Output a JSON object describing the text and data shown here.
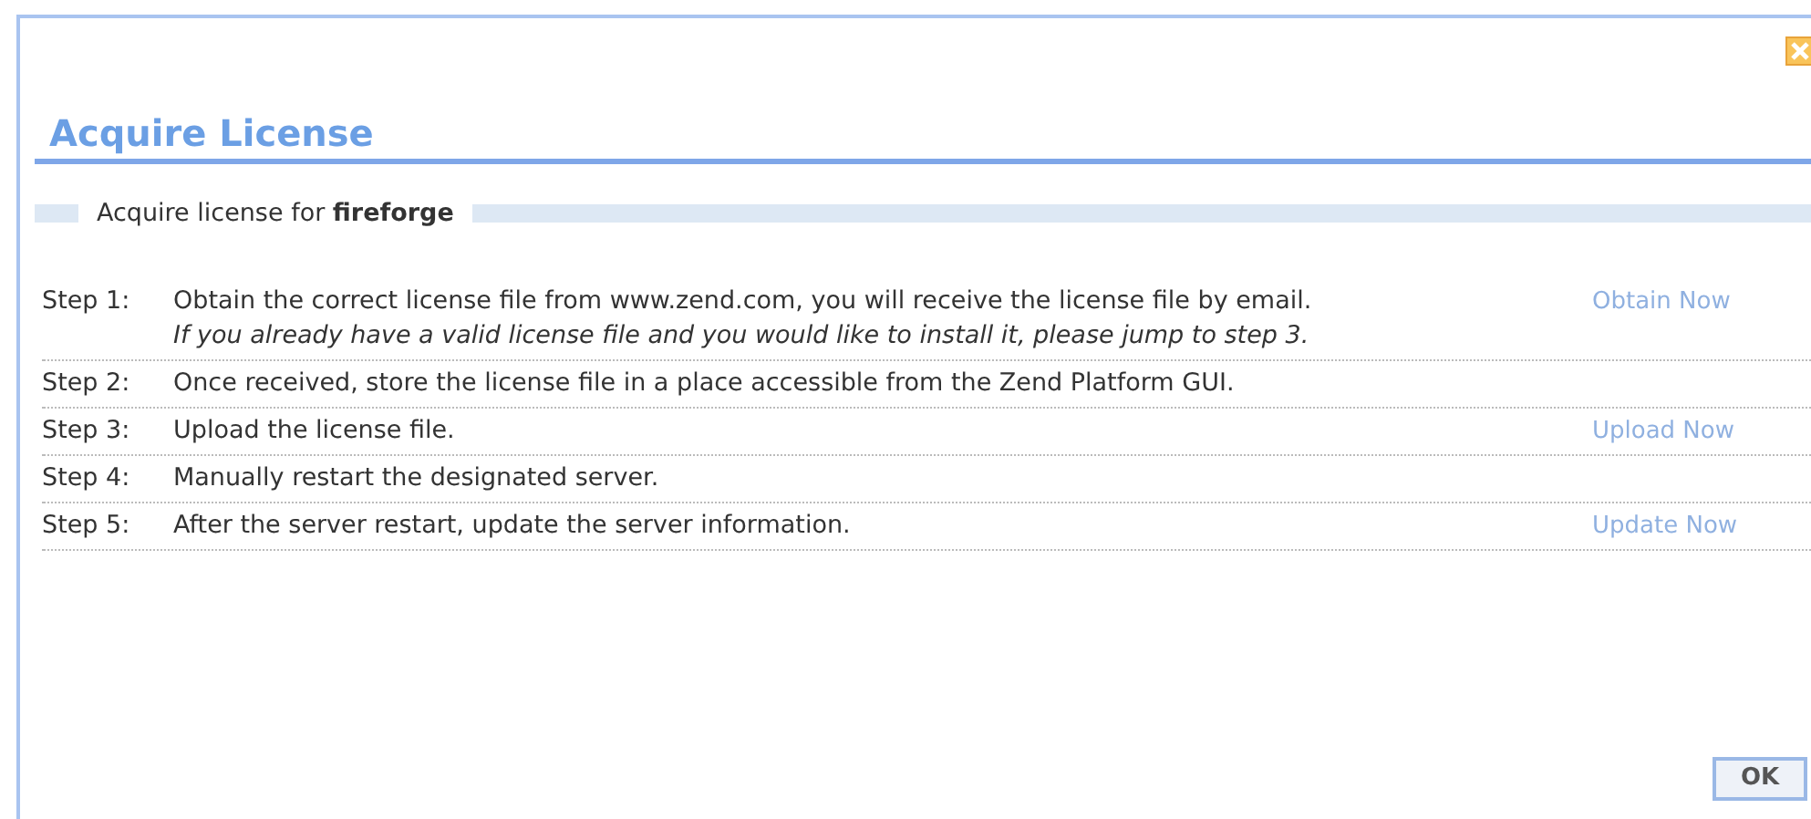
{
  "dialog": {
    "title": "Acquire License",
    "subtitle": "Acquire license for **fireforge**"
  },
  "steps": [
    {
      "label": "Step 1:",
      "text": "Obtain the correct license file from www.zend.com, you will receive the license file by email.",
      "note": "If you already have a valid license file and you would like to install it, please jump to step 3.",
      "action": "Obtain Now"
    },
    {
      "label": "Step 2:",
      "text": "Once received, store the license file in a place accessible from the Zend Platform GUI."
    },
    {
      "label": "Step 3:",
      "text": "Upload the license file.",
      "action": "Upload Now"
    },
    {
      "label": "Step 4:",
      "text": "Manually restart the designated server."
    },
    {
      "label": "Step 5:",
      "text": "After the server restart, update the server information.",
      "action": "Update Now"
    }
  ],
  "buttons": [
    {
      "label": "OK"
    }
  ]
}
